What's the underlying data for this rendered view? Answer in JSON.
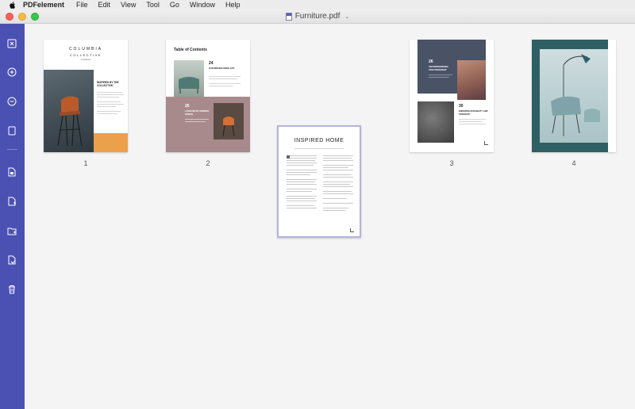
{
  "menubar": {
    "app": "PDFelement",
    "items": [
      "File",
      "Edit",
      "View",
      "Tool",
      "Go",
      "Window",
      "Help"
    ]
  },
  "window": {
    "title": "Furniture.pdf"
  },
  "colors": {
    "rail": "#4b50b3",
    "accent": "#5a5ab6",
    "close": "#fc605c",
    "minimize": "#fdbc40",
    "zoom": "#34c84a"
  },
  "tools": [
    "close-file-icon",
    "zoom-in-icon",
    "zoom-out-icon",
    "blank-page-icon",
    "extract-page-icon",
    "insert-page-icon",
    "add-folder-icon",
    "replace-page-icon",
    "delete-page-icon"
  ],
  "pages": [
    {
      "number": "1",
      "brand_line1": "COLUMBIA",
      "brand_line2": "COLLECTIVE",
      "tagline": "established",
      "heading": "INSPIRED BY THE COLLECTIVE."
    },
    {
      "number": "2",
      "heading": "Table of Contents",
      "entry1_num": "24",
      "entry1_title": "OUR MISSION SINCE 1971",
      "entry2_num": "26",
      "entry2_title": "A MASTER OF MODERN DESIGN"
    },
    {
      "number": "",
      "heading": "INSPIRED HOME"
    },
    {
      "number": "3",
      "entry1_num": "26",
      "entry1_title": "UNCOMPROMISING CRAFTSMANSHIP",
      "entry2_num": "30",
      "entry2_title": "ENDURING DURABILITY AND STRENGTH"
    },
    {
      "number": "4"
    }
  ]
}
